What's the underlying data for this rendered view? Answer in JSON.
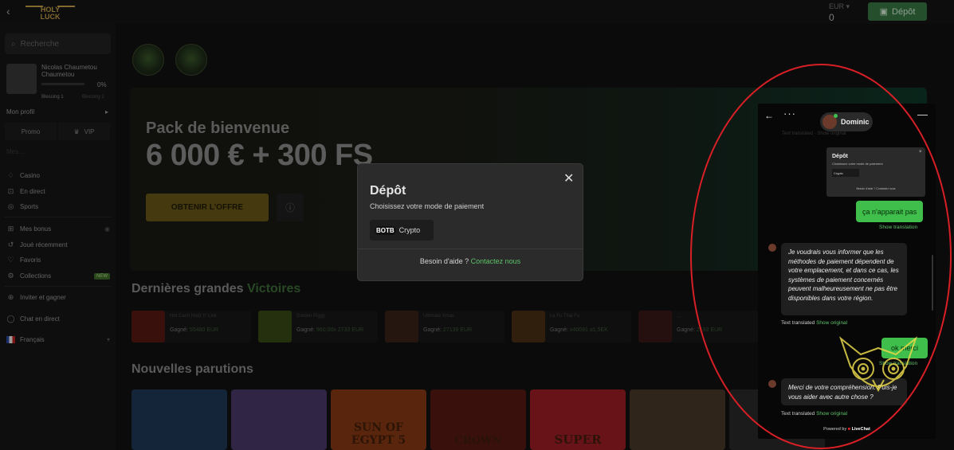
{
  "topbar": {
    "logo_text": "HOLY LUCK",
    "balance_currency": "EUR",
    "balance_amount": "0",
    "deposit_label": "Dépôt"
  },
  "sidebar": {
    "search_placeholder": "Recherche",
    "profile": {
      "name": "Nicolas Chaumetou Chaumetou",
      "progress": "0%",
      "level_current": "Blessing 1",
      "level_next": "Blessing 2",
      "progress_fraction": 0
    },
    "my_profile_label": "Mon profil",
    "promo_label": "Promo",
    "vip_label": "VIP",
    "faded_label": "Mes ...",
    "nav_primary": [
      {
        "icon": "casino-icon",
        "label": "Casino"
      },
      {
        "icon": "live-icon",
        "label": "En direct"
      },
      {
        "icon": "sports-icon",
        "label": "Sports"
      }
    ],
    "nav_secondary": [
      {
        "icon": "gift-icon",
        "label": "Mes bonus"
      },
      {
        "icon": "history-icon",
        "label": "Joué récemment"
      },
      {
        "icon": "heart-icon",
        "label": "Favoris"
      },
      {
        "icon": "collections-icon",
        "label": "Collections",
        "badge": "NEW"
      }
    ],
    "nav_tertiary": [
      {
        "icon": "invite-icon",
        "label": "Inviter et gagner"
      },
      {
        "icon": "chat-icon",
        "label": "Chat en direct"
      },
      {
        "icon": "flag-fr-icon",
        "label": "Français"
      }
    ]
  },
  "main": {
    "banner": {
      "title": "Pack de bienvenue",
      "amount": "6 000 € + 300 FS",
      "cta_label": "OBTENIR L'OFFRE"
    },
    "big_wins": {
      "title_prefix": "Dernières grandes",
      "title_highlight": "Victoires",
      "cards": [
        {
          "game": "Hot Cash Hold 'n' Link",
          "line3_prefix": "Gagné:",
          "amount": "55480 EUR",
          "color": "#6a1a14"
        },
        {
          "game": "Golden Piggy",
          "line3_prefix": "Gagné:",
          "amount": "960,00x 2733 EUR",
          "color": "#3a4a18"
        },
        {
          "game": "Ultimate Xmas",
          "line3_prefix": "Gagné:",
          "amount": "27139 EUR",
          "color": "#3a2418"
        },
        {
          "game": "Le Fu Thai Fu",
          "line3_prefix": "Gagné:",
          "amount": "x40091 a1,5EK",
          "color": "#4a3014"
        },
        {
          "game": "...",
          "line3_prefix": "Gagné:",
          "amount": "2193 EUR",
          "color": "#3a1a18"
        }
      ]
    },
    "new_releases": {
      "title": "Nouvelles parutions",
      "tiles": [
        {
          "text": "",
          "color": "#2c4a6a"
        },
        {
          "text": "",
          "color": "#4a3a6a"
        },
        {
          "text": "SUN OF EGYPT 5",
          "color": "#b84a14"
        },
        {
          "text": "CROWN",
          "color": "#7a1a14"
        },
        {
          "text": "SUPER",
          "color": "#c2282e"
        },
        {
          "text": "",
          "color": "#4a3a2a"
        },
        {
          "text": "",
          "color": "#2a2a2a"
        }
      ]
    }
  },
  "modal": {
    "title": "Dépôt",
    "subtitle": "Choisissez votre mode de paiement",
    "method_logo": "BOTB",
    "method_label": "Crypto",
    "help_text": "Besoin d'aide ?",
    "help_link": "Contactez nous"
  },
  "chat": {
    "agent_name": "Dominic",
    "faded_line": "Text translated · Show original",
    "thumb_title": "Dépôt",
    "thumb_subtitle": "Choisissez votre mode de paiement",
    "thumb_method": "Crypto",
    "thumb_help": "Besoin d'aide ? Contactez nous",
    "user_msg1": "ça n'apparait pas",
    "show_translation1": "Show translation",
    "agent_msg1": "Je voudrais vous informer que les méthodes de paiement dépendent de votre emplacement, et dans ce cas, les systèmes de paiement concernés peuvent malheureusement ne pas être disponibles dans votre région.",
    "translated_label1": "Text translated",
    "show_original1": "Show original",
    "user_msg2": "ok merci",
    "show_translation2": "Show translation",
    "agent_msg2": "Merci de votre compréhension. Puis-je vous aider avec autre chose ?",
    "translated_label2": "Text translated",
    "show_original2": "Show original",
    "powered_prefix": "Powered by",
    "powered_brand": "LiveChat"
  },
  "colors": {
    "accent_green": "#3fbe4b",
    "annotation_red": "#d81f26",
    "gold": "#c9a44a"
  }
}
